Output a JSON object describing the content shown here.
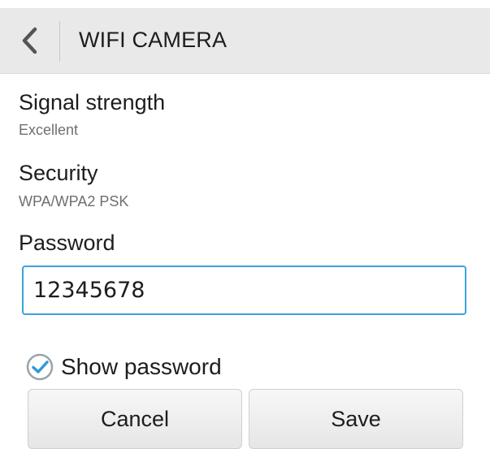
{
  "header": {
    "title": "WIFI CAMERA",
    "back_icon": "chevron-left-icon"
  },
  "details": {
    "signal": {
      "label": "Signal strength",
      "value": "Excellent"
    },
    "security": {
      "label": "Security",
      "value": "WPA/WPA2 PSK"
    }
  },
  "password": {
    "label": "Password",
    "value": "12345678"
  },
  "show_password": {
    "label": "Show password",
    "checked": true,
    "icon": "check-circle-icon"
  },
  "buttons": {
    "cancel": "Cancel",
    "save": "Save"
  },
  "colors": {
    "accent": "#3aa3dc",
    "action_bar": "#e9e9e9"
  }
}
